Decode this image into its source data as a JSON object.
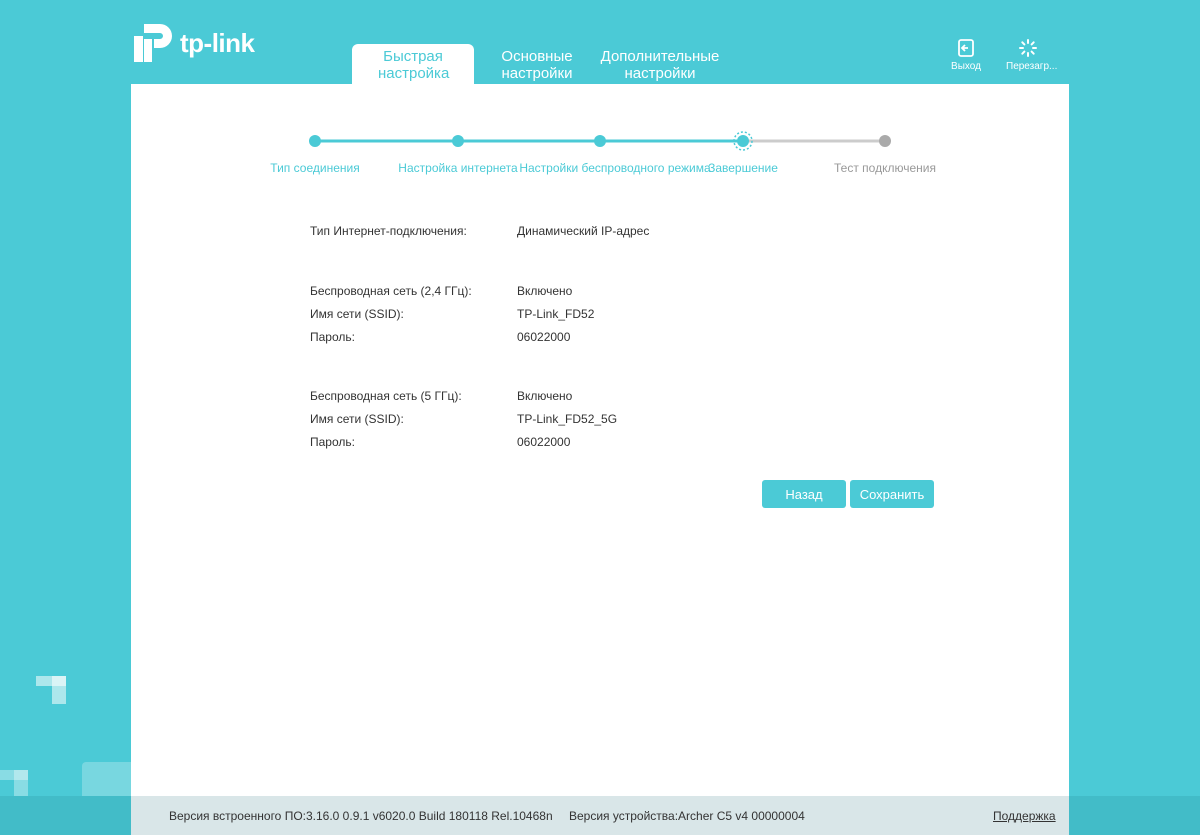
{
  "logo": {
    "text": "tp-link"
  },
  "tabs": [
    {
      "label": "Быстрая настройка",
      "active": true
    },
    {
      "label": "Основные настройки",
      "active": false
    },
    {
      "label": "Дополнительные настройки",
      "active": false
    }
  ],
  "actions": {
    "logout": {
      "label": "Выход",
      "icon": "logout-icon"
    },
    "reboot": {
      "label": "Перезагр...",
      "icon": "reboot-icon"
    }
  },
  "steps": [
    {
      "label": "Тип соединения",
      "state": "done"
    },
    {
      "label": "Настройка интернета",
      "state": "done"
    },
    {
      "label": "Настройки беспроводного режима",
      "state": "done"
    },
    {
      "label": "Завершение",
      "state": "current"
    },
    {
      "label": "Тест подключения",
      "state": "pending"
    }
  ],
  "summary": {
    "connection_type": {
      "label": "Тип Интернет-подключения:",
      "value": "Динамический IP-адрес"
    },
    "wifi24": {
      "status_label": "Беспроводная сеть (2,4 ГГц):",
      "status": "Включено",
      "ssid_label": "Имя сети (SSID):",
      "ssid": "TP-Link_FD52",
      "password_label": "Пароль:",
      "password": "06022000"
    },
    "wifi5": {
      "status_label": "Беспроводная сеть (5 ГГц):",
      "status": "Включено",
      "ssid_label": "Имя сети (SSID):",
      "ssid": "TP-Link_FD52_5G",
      "password_label": "Пароль:",
      "password": "06022000"
    }
  },
  "buttons": {
    "back": "Назад",
    "save": "Сохранить"
  },
  "footer": {
    "firmware": "Версия встроенного ПО:3.16.0 0.9.1 v6020.0 Build 180118 Rel.10468n",
    "hardware": "Версия устройства:Archer C5 v4 00000004",
    "support": "Поддержка"
  },
  "colors": {
    "accent": "#4bcad6",
    "pending": "#aaaaaa",
    "footer_bg": "#d9e6e8"
  }
}
